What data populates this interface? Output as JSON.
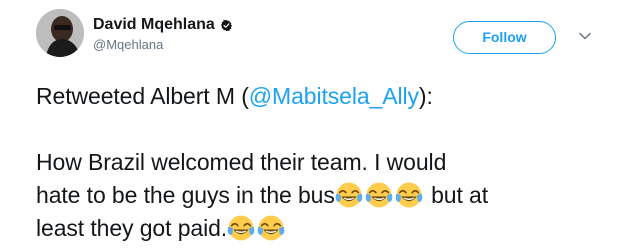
{
  "user": {
    "display_name": "David Mqehlana",
    "handle": "@Mqehlana",
    "verified_icon": "verified-badge-icon"
  },
  "actions": {
    "follow_label": "Follow",
    "more_icon": "chevron-down-icon"
  },
  "tweet": {
    "retweet_prefix": "Retweeted Albert M (",
    "retweet_mention": "@Mabitsela_Ally",
    "retweet_suffix": "):",
    "line1": "How Brazil welcomed their team. I would",
    "line2_text": "hate to be the guys in the bus",
    "line2_after": " but at",
    "line3_text": "least they got paid.",
    "emoji_name": "face-with-tears-of-joy-icon"
  },
  "colors": {
    "accent": "#1da1f2",
    "text": "#14171a",
    "secondary": "#657786"
  }
}
